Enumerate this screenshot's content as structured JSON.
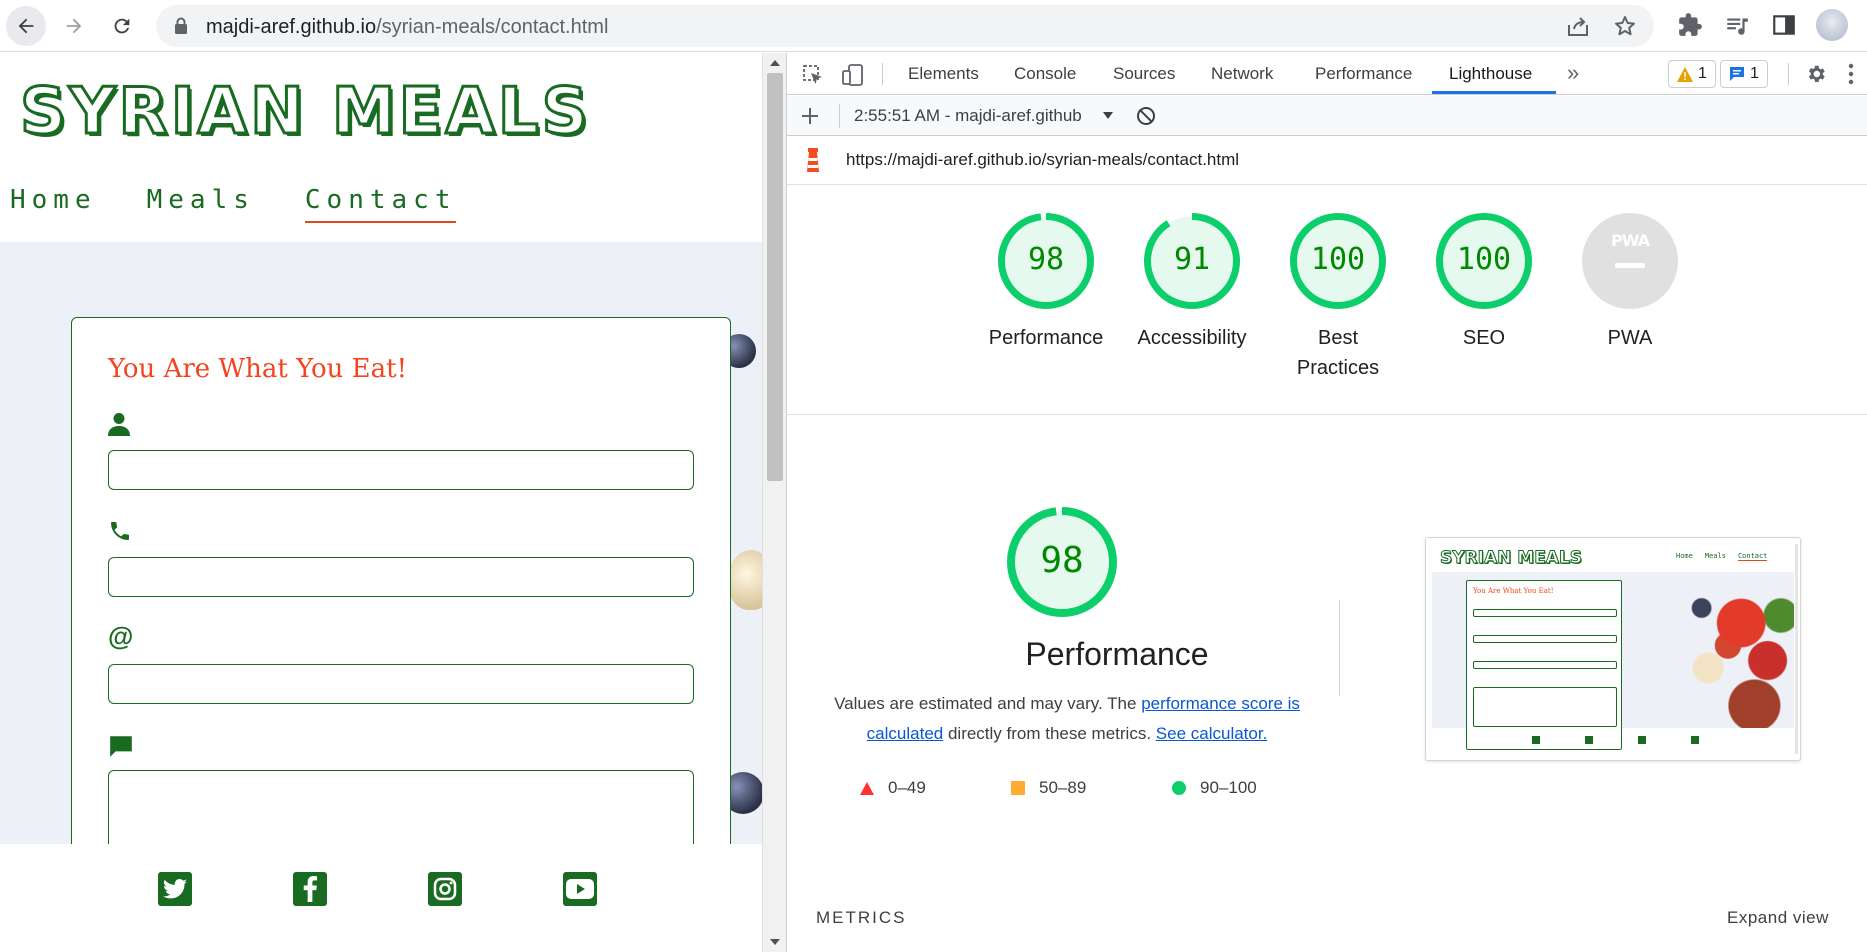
{
  "browser": {
    "url_host": "majdi-aref.github.io",
    "url_path": "/syrian-meals/contact.html",
    "icons": [
      "back-arrow-icon",
      "forward-arrow-icon",
      "reload-icon",
      "lock-icon",
      "share-icon",
      "star-icon",
      "extensions-icon",
      "media-icon",
      "sidepanel-icon",
      "profile-avatar"
    ]
  },
  "site": {
    "logo": "SYRIAN MEALS",
    "nav": [
      {
        "label": "Home"
      },
      {
        "label": "Meals"
      },
      {
        "label": "Contact",
        "active": true
      }
    ],
    "form_title": "You Are What You Eat!",
    "field_icons": [
      "person-icon",
      "phone-icon",
      "at-icon",
      "comment-icon"
    ],
    "at_symbol": "@",
    "social": [
      "twitter-icon",
      "facebook-icon",
      "instagram-icon",
      "youtube-icon"
    ],
    "colors": {
      "brand_green": "#1a6b22",
      "accent_orange": "#f2451f"
    }
  },
  "devtools": {
    "tabs": [
      "Elements",
      "Console",
      "Sources",
      "Network",
      "Performance",
      "Lighthouse"
    ],
    "active_tab": "Lighthouse",
    "more_tabs": "»",
    "warning_count": "1",
    "message_count": "1",
    "report_selector": "2:55:51 AM - majdi-aref.github",
    "report_url": "https://majdi-aref.github.io/syrian-meals/contact.html",
    "scores": [
      {
        "label": "Performance",
        "value": "98",
        "score": 98
      },
      {
        "label": "Accessibility",
        "value": "91",
        "score": 91
      },
      {
        "label": "Best Practices",
        "label_line1": "Best",
        "label_line2": "Practices",
        "value": "100",
        "score": 100
      },
      {
        "label": "SEO",
        "value": "100",
        "score": 100
      },
      {
        "label": "PWA",
        "value": "PWA",
        "score": null
      }
    ],
    "perf": {
      "score": "98",
      "title": "Performance",
      "desc_prefix": "Values are estimated and may vary. The ",
      "desc_link1": "performance score is calculated",
      "desc_middle": " directly from these metrics. ",
      "desc_link2": "See calculator."
    },
    "legend": [
      {
        "range": "0–49",
        "shape": "triangle",
        "color": "#ff3333"
      },
      {
        "range": "50–89",
        "shape": "square",
        "color": "#ffaa33"
      },
      {
        "range": "90–100",
        "shape": "circle",
        "color": "#0cce6b"
      }
    ],
    "thumbnail": {
      "logo": "SYRIAN MEALS",
      "nav": [
        "Home",
        "Meals",
        "Contact"
      ],
      "form_title": "You Are What You Eat!"
    },
    "metrics_label": "METRICS",
    "expand_view": "Expand view",
    "colors": {
      "pass": "#0cce6b",
      "pass_text": "#008800",
      "tab_accent": "#1a73e8"
    }
  }
}
